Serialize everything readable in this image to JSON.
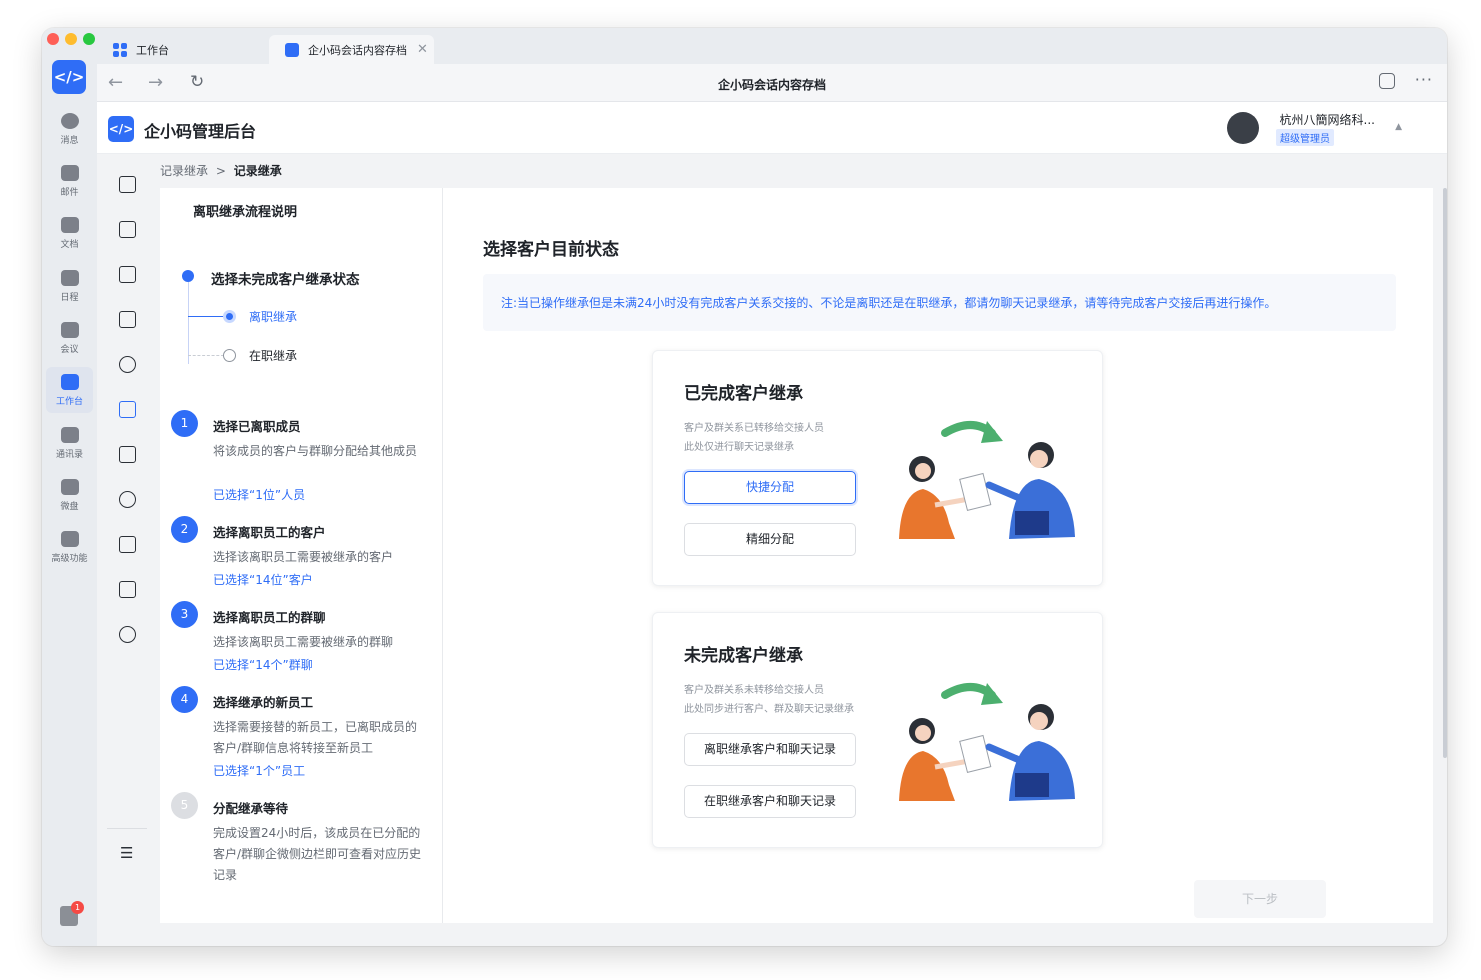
{
  "rail": {
    "items": [
      {
        "label": "消息"
      },
      {
        "label": "邮件"
      },
      {
        "label": "文档"
      },
      {
        "label": "日程"
      },
      {
        "label": "会议"
      },
      {
        "label": "工作台"
      },
      {
        "label": "通讯录"
      },
      {
        "label": "微盘"
      },
      {
        "label": "高级功能"
      }
    ],
    "badge_count": "1"
  },
  "tabs": [
    {
      "label": "工作台"
    },
    {
      "label": "企小码会话内容存档"
    }
  ],
  "navbar": {
    "title": "企小码会话内容存档"
  },
  "header": {
    "title": "企小码管理后台",
    "company": "杭州八簡网络科...",
    "role": "超级管理员"
  },
  "breadcrumb": {
    "parent": "记录继承",
    "separator": ">",
    "current": "记录继承"
  },
  "steps_pane": {
    "title": "离职继承流程说明",
    "status_title": "选择未完成客户继承状态",
    "options": [
      {
        "label": "离职继承",
        "selected": true
      },
      {
        "label": "在职继承",
        "selected": false
      }
    ],
    "steps": [
      {
        "num": "1",
        "title": "选择已离职成员",
        "desc": "将该成员的客户与群聊分配给其他成员",
        "done": "已选择“1位”人员"
      },
      {
        "num": "2",
        "title": "选择离职员工的客户",
        "desc": "选择该离职员工需要被继承的客户",
        "done": "已选择“14位”客户"
      },
      {
        "num": "3",
        "title": "选择离职员工的群聊",
        "desc": "选择该离职员工需要被继承的群聊",
        "done": "已选择“14个”群聊"
      },
      {
        "num": "4",
        "title": "选择继承的新员工",
        "desc": "选择需要接替的新员工，已离职成员的客户/群聊信息将转接至新员工",
        "done": "已选择“1个”员工"
      },
      {
        "num": "5",
        "title": "分配继承等待",
        "desc": "完成设置24小时后，该成员在已分配的客户/群聊企微侧边栏即可查看对应历史记录",
        "done": ""
      }
    ]
  },
  "content": {
    "title": "选择客户目前状态",
    "notice": "注:当已操作继承但是未满24小时没有完成客户关系交接的、不论是离职还是在职继承，都请勿聊天记录继承，请等待完成客户交接后再进行操作。",
    "cards": [
      {
        "title": "已完成客户继承",
        "desc1": "客户及群关系已转移给交接人员",
        "desc2": "此处仅进行聊天记录继承",
        "btn1": "快捷分配",
        "btn2": "精细分配"
      },
      {
        "title": "未完成客户继承",
        "desc1": "客户及群关系未转移给交接人员",
        "desc2": "此处同步进行客户、群及聊天记录继承",
        "btn1": "离职继承客户和聊天记录",
        "btn2": "在职继承客户和聊天记录"
      }
    ],
    "next_button": "下一步"
  },
  "colors": {
    "accent": "#2f6df6",
    "arrow": "#4caf6e",
    "shirt_orange": "#e8762d",
    "shirt_blue": "#3b6fd8"
  }
}
